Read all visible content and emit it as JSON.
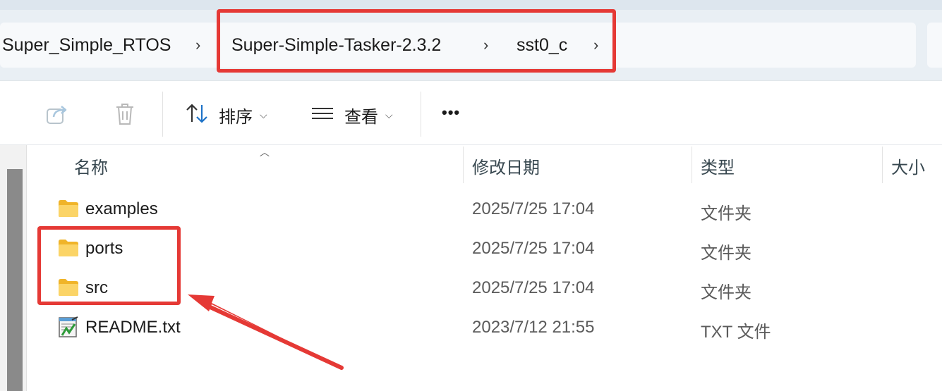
{
  "breadcrumb": {
    "items": [
      "Super_Simple_RTOS",
      "Super-Simple-Tasker-2.3.2",
      "sst0_c"
    ]
  },
  "toolbar": {
    "sort_label": "排序",
    "view_label": "查看",
    "more_label": "•••"
  },
  "columns": {
    "name": "名称",
    "modified": "修改日期",
    "type": "类型",
    "size": "大小"
  },
  "files": [
    {
      "name": "examples",
      "modified": "2025/7/25 17:04",
      "type": "文件夹",
      "icon": "folder-icon"
    },
    {
      "name": "ports",
      "modified": "2025/7/25 17:04",
      "type": "文件夹",
      "icon": "folder-icon"
    },
    {
      "name": "src",
      "modified": "2025/7/25 17:04",
      "type": "文件夹",
      "icon": "folder-icon"
    },
    {
      "name": "README.txt",
      "modified": "2023/7/12 21:55",
      "type": "TXT 文件",
      "icon": "text-file-icon"
    }
  ],
  "colors": {
    "annotation": "#e53935",
    "folder": "#f8c74a"
  }
}
